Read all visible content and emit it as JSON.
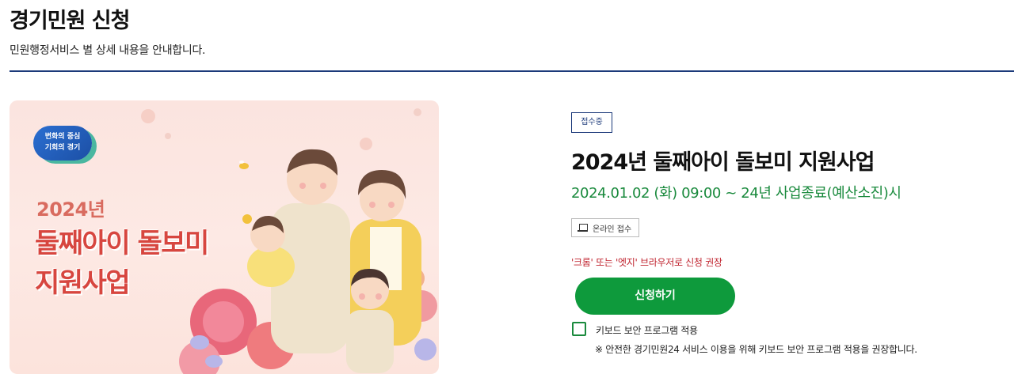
{
  "header": {
    "title": "경기민원 신청",
    "subtitle": "민원행정서비스 별 상세 내용을 안내합니다."
  },
  "banner": {
    "logo_line1": "변화의 중심",
    "logo_line2": "기회의 경기",
    "year": "2024년",
    "title_line1": "둘째아이 돌보미",
    "title_line2": "지원사업"
  },
  "service": {
    "status": "접수중",
    "title": "2024년 둘째아이 돌보미 지원사업",
    "period": "2024.01.02 (화) 09:00 ~ 24년 사업종료(예산소진)시",
    "channel": "온라인 접수",
    "browser_notice": "'크롬' 또는 '엣지' 브라우저로 신청 권장",
    "apply_label": "신청하기",
    "keyboard_checkbox_label": "키보드 보안 프로그램 적용",
    "keyboard_note": "※ 안전한 경기민원24 서비스 이용을 위해 키보드 보안 프로그램 적용을 권장합니다."
  },
  "colors": {
    "accent_green": "#0e9a3c",
    "period_green": "#1a8a3d",
    "divider_navy": "#1c3a7a",
    "notice_red": "#c0242f"
  },
  "icons": [
    "laptop-icon"
  ]
}
